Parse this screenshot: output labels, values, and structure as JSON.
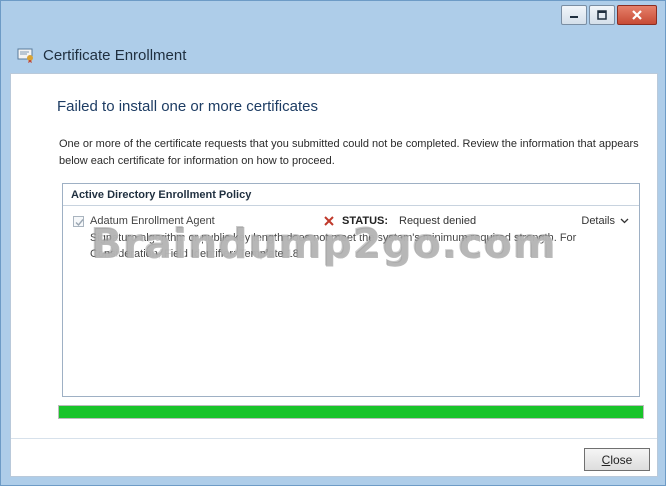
{
  "window": {
    "title": "Certificate Enrollment",
    "controls": [
      "minimize",
      "maximize",
      "close"
    ]
  },
  "main": {
    "heading": "Failed to install one or more certificates",
    "description": "One or more of the certificate requests that you submitted could not be completed. Review the information that appears below each certificate for information on how to proceed.",
    "policy": {
      "title": "Active Directory Enrollment Policy",
      "certificate": {
        "name": "Adatum Enrollment Agent",
        "checked": true,
        "status_label": "STATUS:",
        "status_value": "Request denied",
        "details_label": "Details",
        "message": "Signature algorithm or public key length does not meet the system's minimum required strength. For Consideration, Field Identifier: Template 18"
      }
    },
    "progress": {
      "percent": 100,
      "color": "#19c42a"
    },
    "close_button": "Close"
  },
  "watermark": "Braindump2go.com",
  "colors": {
    "frame": "#aecde9",
    "heading": "#1d3c63",
    "close_control": "#c74b35",
    "error_x": "#c0392b"
  },
  "icons": {
    "window_icon": "certificate-icon",
    "status": "error-x-icon",
    "details": "chevron-down-icon"
  }
}
